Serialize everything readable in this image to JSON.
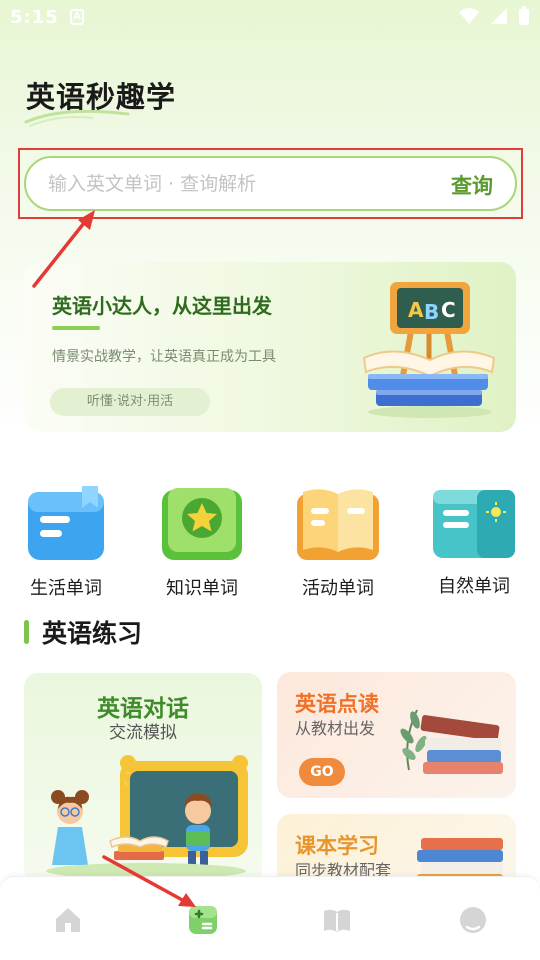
{
  "status_bar": {
    "time": "5:15",
    "notification_letter": "A"
  },
  "app": {
    "title": "英语秒趣学"
  },
  "search": {
    "placeholder": "输入英文单词 · 查询解析",
    "button_label": "查询"
  },
  "banner": {
    "title": "英语小达人，从这里出发",
    "subtitle": "情景实战教学，让英语真正成为工具",
    "pill": "听懂·说对·用活",
    "board_letters": [
      "A",
      "B",
      "C"
    ]
  },
  "categories": [
    {
      "label": "生活单词",
      "icon": "blue-notebook-icon"
    },
    {
      "label": "知识单词",
      "icon": "green-star-book-icon"
    },
    {
      "label": "活动单词",
      "icon": "orange-open-book-icon"
    },
    {
      "label": "自然单词",
      "icon": "teal-sun-card-icon"
    }
  ],
  "practice": {
    "section_title": "英语练习",
    "dialog_card": {
      "title": "英语对话",
      "subtitle": "交流模拟"
    },
    "read_card": {
      "title": "英语点读",
      "subtitle": "从教材出发",
      "button": "GO"
    },
    "textbook_card": {
      "title": "课本学习",
      "subtitle": "同步教材配套"
    }
  },
  "tabs": [
    {
      "name": "home",
      "icon": "home-icon",
      "active": false
    },
    {
      "name": "practice",
      "icon": "practice-icon",
      "active": true
    },
    {
      "name": "book",
      "icon": "book-icon",
      "active": false
    },
    {
      "name": "profile",
      "icon": "profile-icon",
      "active": false
    }
  ],
  "colors": {
    "accent_green": "#7dc44b",
    "dark_green": "#3f8a2a",
    "orange": "#f07126",
    "highlight_red": "#e23d3d"
  }
}
